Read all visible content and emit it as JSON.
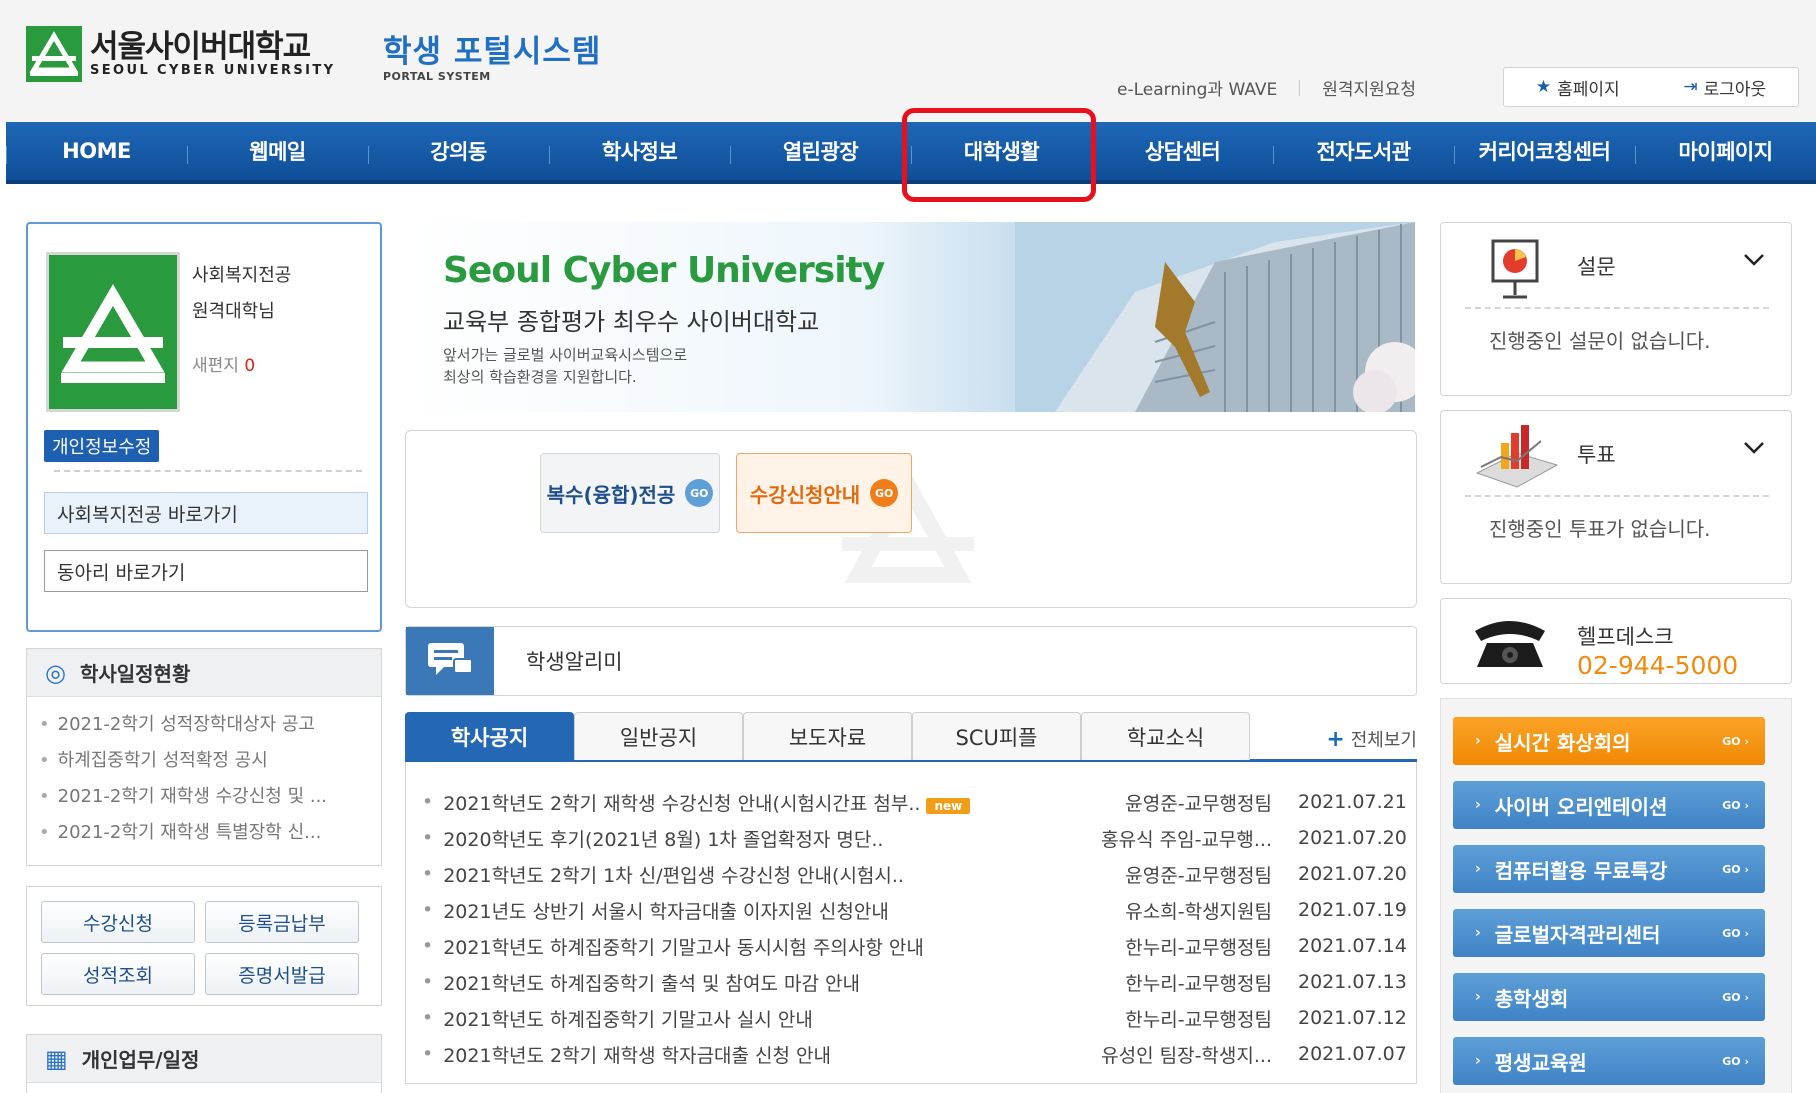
{
  "header": {
    "logo_ko": "서울사이버대학교",
    "logo_en": "SEOUL CYBER UNIVERSITY",
    "portal_ko": "학생 포털시스템",
    "portal_en": "PORTAL SYSTEM",
    "util_links": [
      "e-Learning과 WAVE",
      "원격지원요청"
    ],
    "home_label": "홈페이지",
    "logout_label": "로그아웃"
  },
  "nav": {
    "items": [
      "HOME",
      "웹메일",
      "강의동",
      "학사정보",
      "열린광장",
      "대학생활",
      "상담센터",
      "전자도서관",
      "커리어코칭센터",
      "마이페이지"
    ],
    "highlighted": "대학생활"
  },
  "profile": {
    "major": "사회복지전공",
    "name": "원격대학님",
    "mail_label": "새편지",
    "mail_count": "0",
    "privacy_badge": "개인정보수정",
    "major_link": "사회복지전공 바로가기",
    "club_link": "동아리 바로가기"
  },
  "schedule": {
    "title": "학사일정현황",
    "items": [
      "2021-2학기 성적장학대상자 공고",
      "하계집중학기 성적확정 공시",
      "2021-2학기 재학생 수강신청 및 ...",
      "2021-2학기 재학생 특별장학 신..."
    ]
  },
  "quick": {
    "buttons": [
      "수강신청",
      "등록금납부",
      "성적조회",
      "증명서발급"
    ]
  },
  "personal": {
    "title": "개인업무/일정"
  },
  "banner": {
    "title": "Seoul Cyber University",
    "subtitle": "교육부 종합평가 최우수 사이버대학교",
    "desc1": "앞서가는 글로벌 사이버교육시스템으로",
    "desc2": "최상의 학습환경을 지원합니다."
  },
  "go_buttons": {
    "double_major": "복수(융합)전공",
    "enroll_guide": "수강신청안내",
    "go": "GO"
  },
  "notifier": {
    "label": "학생알리미"
  },
  "tabs": {
    "items": [
      "학사공지",
      "일반공지",
      "보도자료",
      "SCU피플",
      "학교소식"
    ],
    "active": "학사공지",
    "view_all": "전체보기"
  },
  "notices": [
    {
      "title": "2021학년도 2학기 재학생 수강신청 안내(시험시간표 첨부..",
      "new": "new",
      "author": "윤영준-교무행정팀",
      "date": "2021.07.21"
    },
    {
      "title": "2020학년도 후기(2021년 8월) 1차 졸업확정자 명단..",
      "new": "",
      "author": "홍유식 주임-교무행...",
      "date": "2021.07.20"
    },
    {
      "title": "2021학년도 2학기 1차 신/편입생 수강신청 안내(시험시..",
      "new": "",
      "author": "윤영준-교무행정팀",
      "date": "2021.07.20"
    },
    {
      "title": "2021년도 상반기 서울시 학자금대출 이자지원 신청안내",
      "new": "",
      "author": "유소희-학생지원팀",
      "date": "2021.07.19"
    },
    {
      "title": "2021학년도 하계집중학기 기말고사 동시시험 주의사항 안내",
      "new": "",
      "author": "한누리-교무행정팀",
      "date": "2021.07.14"
    },
    {
      "title": "2021학년도 하계집중학기 출석 및 참여도 마감 안내",
      "new": "",
      "author": "한누리-교무행정팀",
      "date": "2021.07.13"
    },
    {
      "title": "2021학년도 하계집중학기 기말고사 실시 안내",
      "new": "",
      "author": "한누리-교무행정팀",
      "date": "2021.07.12"
    },
    {
      "title": "2021학년도 2학기 재학생 학자금대출 신청 안내",
      "new": "",
      "author": "유성인 팀장-학생지...",
      "date": "2021.07.07"
    }
  ],
  "survey": {
    "title": "설문",
    "message": "진행중인 설문이 없습니다."
  },
  "vote": {
    "title": "투표",
    "message": "진행중인 투표가 없습니다."
  },
  "helpdesk": {
    "title": "헬프데스크",
    "phone": "02-944-5000"
  },
  "side_links": {
    "items": [
      "실시간 화상회의",
      "사이버 오리엔테이션",
      "컴퓨터활용 무료특강",
      "글로벌자격관리센터",
      "총학생회",
      "평생교육원"
    ],
    "go": "GO ›"
  },
  "colors": {
    "brand_green": "#2a9a3e",
    "nav_blue": "#1e67b7",
    "highlight_red": "#e8101c",
    "accent_orange": "#f28a10"
  }
}
